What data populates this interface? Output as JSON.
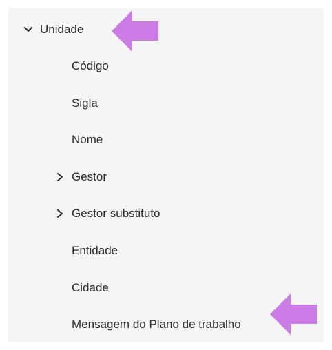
{
  "tree": {
    "root": {
      "label": "Unidade",
      "expanded": true
    },
    "children": [
      {
        "label": "Código",
        "expandable": false
      },
      {
        "label": "Sigla",
        "expandable": false
      },
      {
        "label": "Nome",
        "expandable": false
      },
      {
        "label": "Gestor",
        "expandable": true,
        "expanded": false
      },
      {
        "label": "Gestor substituto",
        "expandable": true,
        "expanded": false
      },
      {
        "label": "Entidade",
        "expandable": false
      },
      {
        "label": "Cidade",
        "expandable": false
      },
      {
        "label": "Mensagem do Plano de trabalho",
        "expandable": false
      }
    ]
  },
  "annotations": {
    "arrow_color": "#cc7be6",
    "arrow_icon": "left-pointing-arrow"
  },
  "colors": {
    "panel_background": "#f5f5f6",
    "text": "#2b2b2b"
  }
}
